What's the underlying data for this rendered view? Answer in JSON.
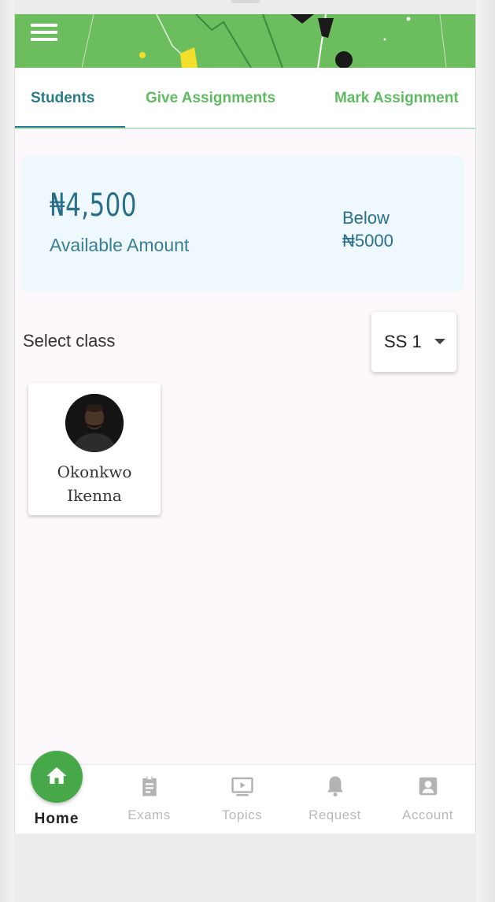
{
  "tabs": [
    {
      "label": "Students",
      "active": true
    },
    {
      "label": "Give Assignments",
      "active": false
    },
    {
      "label": "Mark Assignment",
      "active": false
    }
  ],
  "balance": {
    "amount": "₦4,500",
    "label": "Available Amount",
    "threshold_line1": "Below",
    "threshold_line2": "₦5000"
  },
  "class_filter": {
    "label": "Select class",
    "selected": "SS 1"
  },
  "students": [
    {
      "first_name": "Okonkwo",
      "last_name": "Ikenna"
    }
  ],
  "bottom_nav": {
    "home": "Home",
    "exams": "Exams",
    "topics": "Topics",
    "request": "Request",
    "account": "Account"
  },
  "colors": {
    "brand_green": "#47a84a",
    "header_green": "#6cbd5e",
    "tab_active": "#2a7b8a",
    "tab_inactive": "#5fbb62",
    "card_bg": "#eef8fd"
  }
}
